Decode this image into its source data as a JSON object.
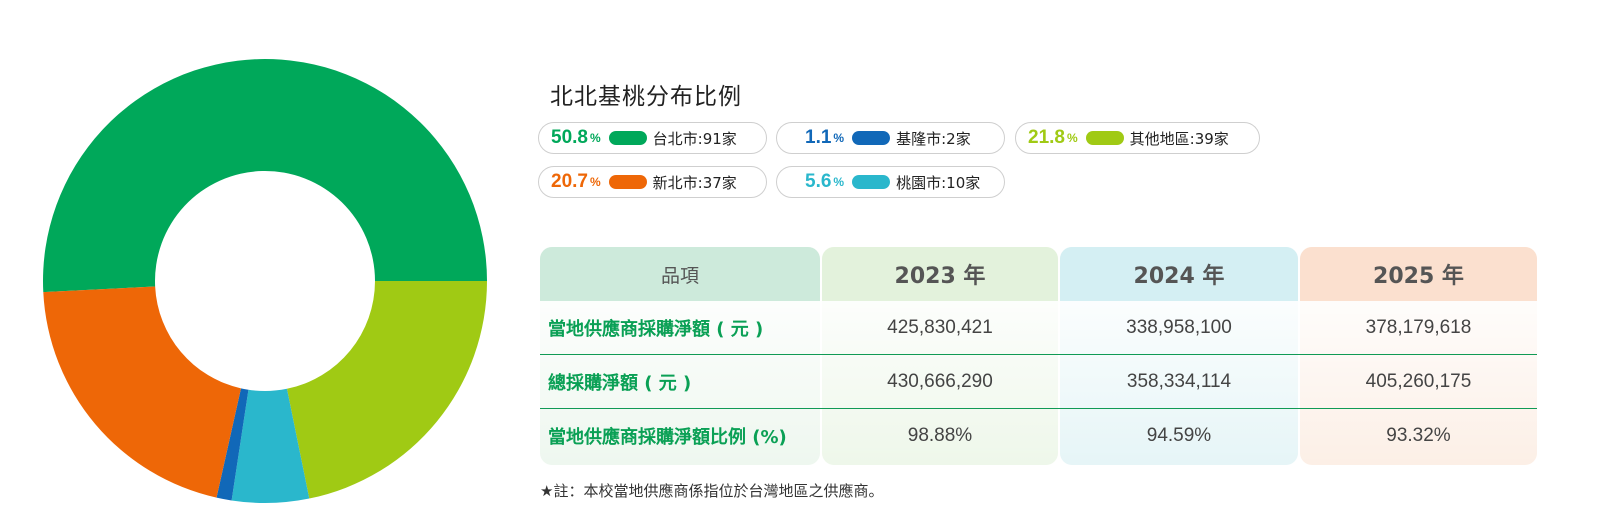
{
  "chart_data": {
    "type": "pie",
    "title": "北北基桃分布比例",
    "series": [
      {
        "name": "台北市:91家",
        "value": 50.8,
        "pct_label": "50.8",
        "color": "#00a85a"
      },
      {
        "name": "其他地區:39家",
        "value": 21.8,
        "pct_label": "21.8",
        "color": "#a0ca14"
      },
      {
        "name": "桃園市:10家",
        "value": 5.6,
        "pct_label": "5.6",
        "color": "#2ab7cc"
      },
      {
        "name": "基隆市:2家",
        "value": 1.1,
        "pct_label": "1.1",
        "color": "#1168b8"
      },
      {
        "name": "新北市:37家",
        "value": 20.7,
        "pct_label": "20.7",
        "color": "#ee6707"
      }
    ],
    "percent_unit": "%",
    "legend_rows": [
      [
        "台北市:91家",
        "基隆市:2家",
        "其他地區:39家"
      ],
      [
        "新北市:37家",
        "桃園市:10家"
      ]
    ]
  },
  "table": {
    "header_item": "品項",
    "years": [
      "2023 年",
      "2024 年",
      "2025 年"
    ],
    "header_colors": [
      "#e3f2dc",
      "#d4eff3",
      "#fbe0cf"
    ],
    "body_colors": [
      "#eef7ea",
      "#e6f5f7",
      "#fcefe6"
    ],
    "item_head_color": "#cdeadb",
    "rows": [
      {
        "label": "當地供應商採購淨額 ( 元 )",
        "values": [
          "425,830,421",
          "338,958,100",
          "378,179,618"
        ]
      },
      {
        "label": "總採購淨額 ( 元 )",
        "values": [
          "430,666,290",
          "358,334,114",
          "405,260,175"
        ]
      },
      {
        "label": "當地供應商採購淨額比例 (%)",
        "values": [
          "98.88%",
          "94.59%",
          "93.32%"
        ]
      }
    ]
  },
  "note": "★註：本校當地供應商係指位於台灣地區之供應商。"
}
